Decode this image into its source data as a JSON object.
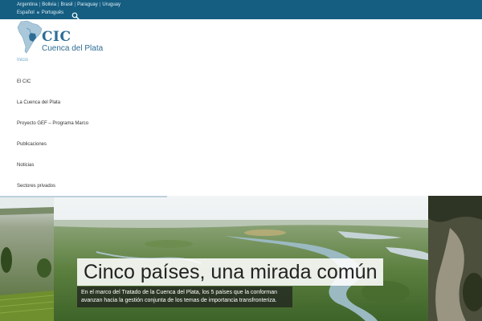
{
  "topbar": {
    "countries": [
      "Argentina",
      "Bolivia",
      "Brasil",
      "Paraguay",
      "Uruguay"
    ],
    "separator": "|",
    "languages": [
      "Español",
      "Português"
    ],
    "language_separator": "■",
    "search_icon": "search-icon"
  },
  "logo": {
    "acronym": "CIC",
    "name": "Cuenca del Plata",
    "icon": "south-america-map-icon"
  },
  "menu": {
    "items": [
      {
        "label": "Inicio",
        "active": true
      },
      {
        "label": "El CIC",
        "active": false
      },
      {
        "label": "La Cuenca del Plata",
        "active": false
      },
      {
        "label": "Proyecto GEF – Programa Marco",
        "active": false
      },
      {
        "label": "Publicaciones",
        "active": false
      },
      {
        "label": "Noticias",
        "active": false
      },
      {
        "label": "Sectores privados",
        "active": false
      }
    ]
  },
  "hero": {
    "title": "Cinco países, una mirada común",
    "caption": "En el marco del Tratado de la Cuenca del Plata, los 5 países que la conforman avanzan hacia la gestión conjunta de los temas de importancia transfronteriza."
  },
  "colors": {
    "topbar": "#155e82",
    "brand": "#2d6d95",
    "active_menu": "#6fa9c8"
  }
}
